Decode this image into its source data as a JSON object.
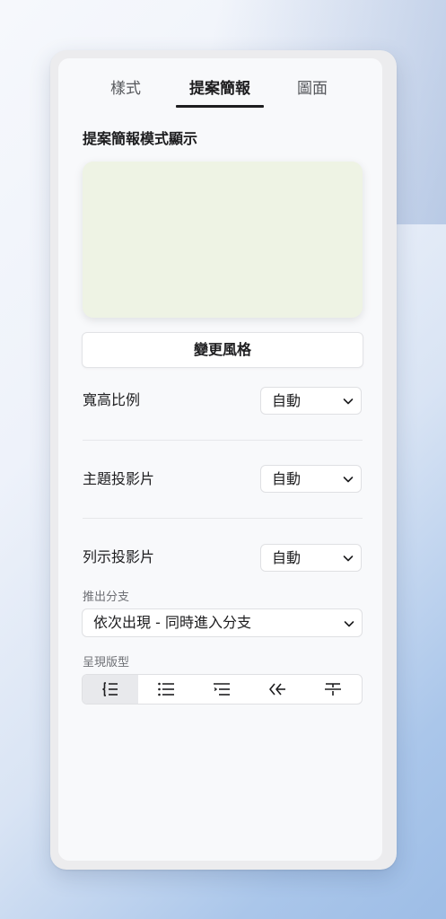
{
  "tabs": [
    {
      "label": "樣式"
    },
    {
      "label": "提案簡報",
      "active": true
    },
    {
      "label": "圖面"
    }
  ],
  "section_title": "提案簡報模式顯示",
  "preview": {
    "color": "#eef3e4"
  },
  "change_style_label": "變更風格",
  "aspect_ratio": {
    "label": "寬高比例",
    "value": "自動"
  },
  "title_slide": {
    "label": "主題投影片",
    "value": "自動"
  },
  "list_slide": {
    "label": "列示投影片",
    "value": "自動"
  },
  "branch": {
    "label": "推出分支",
    "value": "依次出現 - 同時進入分支"
  },
  "layout": {
    "label": "呈現版型",
    "options": [
      {
        "icon": "bracket-list-icon",
        "selected": true
      },
      {
        "icon": "bullet-list-icon",
        "selected": false
      },
      {
        "icon": "indented-list-icon",
        "selected": false
      },
      {
        "icon": "branch-arrow-icon",
        "selected": false
      },
      {
        "icon": "split-icon",
        "selected": false
      }
    ]
  }
}
